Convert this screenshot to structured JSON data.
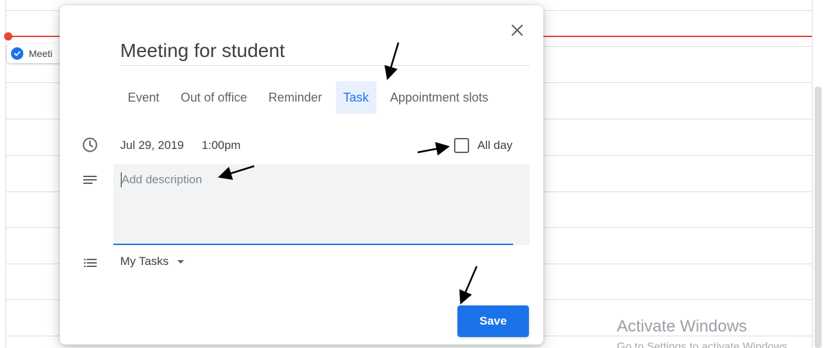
{
  "background": {
    "event_chip_label": "Meeti",
    "watermark": {
      "title": "Activate Windows",
      "subtitle": "Go to Settings to activate Windows."
    }
  },
  "dialog": {
    "title": "Meeting for student",
    "tabs": [
      {
        "label": "Event",
        "active": false
      },
      {
        "label": "Out of office",
        "active": false
      },
      {
        "label": "Reminder",
        "active": false
      },
      {
        "label": "Task",
        "active": true
      },
      {
        "label": "Appointment slots",
        "active": false
      }
    ],
    "date": "Jul 29, 2019",
    "time": "1:00pm",
    "all_day_label": "All day",
    "all_day_checked": false,
    "description_placeholder": "Add description",
    "task_list": "My Tasks",
    "save_label": "Save"
  },
  "icons": {
    "close": "close-icon",
    "clock": "clock-icon",
    "description": "notes-icon",
    "list": "list-icon",
    "dropdown": "caret-down-icon",
    "chip": "check-circle-icon"
  },
  "colors": {
    "accent": "#1a73e8",
    "active_tab_bg": "#e8f0fe",
    "now_line": "#ea4335",
    "field_bg": "#f1f3f4"
  }
}
